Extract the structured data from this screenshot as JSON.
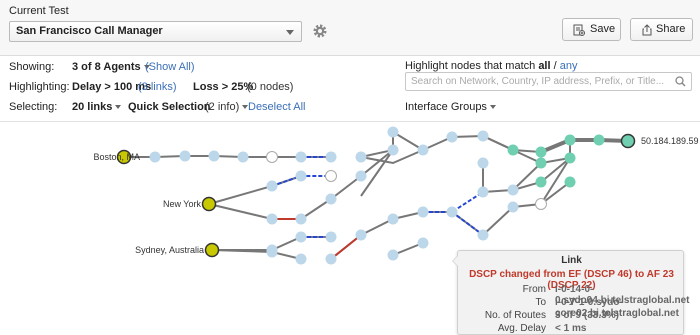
{
  "header": {
    "current_test_label": "Current Test",
    "test_name": "San Francisco Call Manager",
    "save_label": "Save",
    "share_label": "Share"
  },
  "filters": {
    "showing": {
      "label": "Showing:",
      "value": "3 of 8 Agents",
      "link": "(Show All)"
    },
    "highlighting": {
      "label": "Highlighting:",
      "delay_value": "Delay > 100 ms",
      "delay_link": "(3 links)",
      "loss_value": "Loss > 25%",
      "loss_count": "(0 nodes)"
    },
    "selecting": {
      "label": "Selecting:",
      "links_value": "20 links",
      "quick_value": "Quick Selection",
      "quick_count": "(2 info)",
      "deselect_link": "Deselect All"
    },
    "highlight_match": {
      "prefix": "Highlight nodes that match ",
      "all": "all",
      "sep": " / ",
      "any": "any"
    },
    "search_placeholder": "Search on Network, Country, IP address, Prefix, or Title...",
    "interface_groups": "Interface Groups"
  },
  "graph": {
    "agents": [
      "Boston, MA",
      "New York",
      "Sydney, Australia"
    ],
    "target": "50.184.189.59",
    "colors": {
      "agent": "#c8c800",
      "node": "#bdd7ea",
      "target_node": "#6fcfb0",
      "highlight_link": "#2446d6",
      "alert_link": "#c0392b",
      "link": "#777777"
    }
  },
  "tooltip": {
    "title": "Link",
    "alert": "DSCP changed from EF (DSCP 46) to AF 23 (DSCP 22)",
    "rows": [
      {
        "key": "From",
        "value": "i-0-14-0-0.sydo04.bi.telstraglobal.net"
      },
      {
        "key": "To",
        "value": "i-0-7-1-0.sydo-core02.bi.telstraglobal.net"
      },
      {
        "key": "No. of Routes",
        "value": "3 of 9 (33.3%)"
      },
      {
        "key": "Avg. Delay",
        "value": "< 1 ms"
      }
    ]
  }
}
